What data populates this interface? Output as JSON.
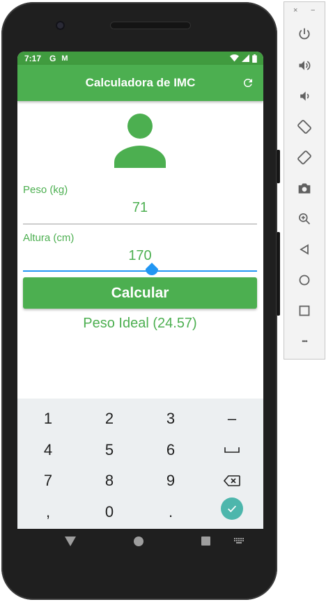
{
  "status_bar": {
    "time": "7:17",
    "notification_icons": [
      "google-g-icon",
      "gmail-icon"
    ],
    "google_glyph": "G",
    "gmail_glyph": "M",
    "right_icons": [
      "wifi-icon",
      "signal-icon",
      "battery-icon"
    ]
  },
  "app_bar": {
    "title": "Calculadora de IMC",
    "refresh_icon": "refresh-icon"
  },
  "form": {
    "avatar_icon": "person-icon",
    "weight": {
      "label": "Peso (kg)",
      "value": "71"
    },
    "height": {
      "label": "Altura (cm)",
      "value": "170"
    },
    "calculate_label": "Calcular",
    "result": "Peso Ideal (24.57)"
  },
  "keyboard": {
    "rows": [
      [
        "1",
        "2",
        "3",
        "–"
      ],
      [
        "4",
        "5",
        "6",
        "space-icon"
      ],
      [
        "7",
        "8",
        "9",
        "backspace-icon"
      ],
      [
        ",",
        "0",
        ".",
        "enter-check-icon"
      ]
    ],
    "key_labels": {
      "k1": "1",
      "k2": "2",
      "k3": "3",
      "minus": "–",
      "k4": "4",
      "k5": "5",
      "k6": "6",
      "k7": "7",
      "k8": "8",
      "k9": "9",
      "comma": ",",
      "k0": "0",
      "dot": "."
    }
  },
  "nav_bar": {
    "buttons": [
      "back-icon",
      "home-icon",
      "recents-icon",
      "keyboard-switch-icon"
    ]
  },
  "emulator_toolbar": {
    "close_glyph": "×",
    "minimize_glyph": "−",
    "buttons": [
      "power-icon",
      "volume-up-icon",
      "volume-down-icon",
      "rotate-left-icon",
      "rotate-right-icon",
      "camera-icon",
      "zoom-icon",
      "back-icon",
      "home-icon",
      "overview-icon",
      "more-icon"
    ],
    "more_glyph": "•••"
  },
  "colors": {
    "primary": "#4caf50",
    "status_bar": "#409b3f",
    "focus": "#2196f3",
    "enter_key": "#4db6ac",
    "keyboard_bg": "#eceff1"
  }
}
